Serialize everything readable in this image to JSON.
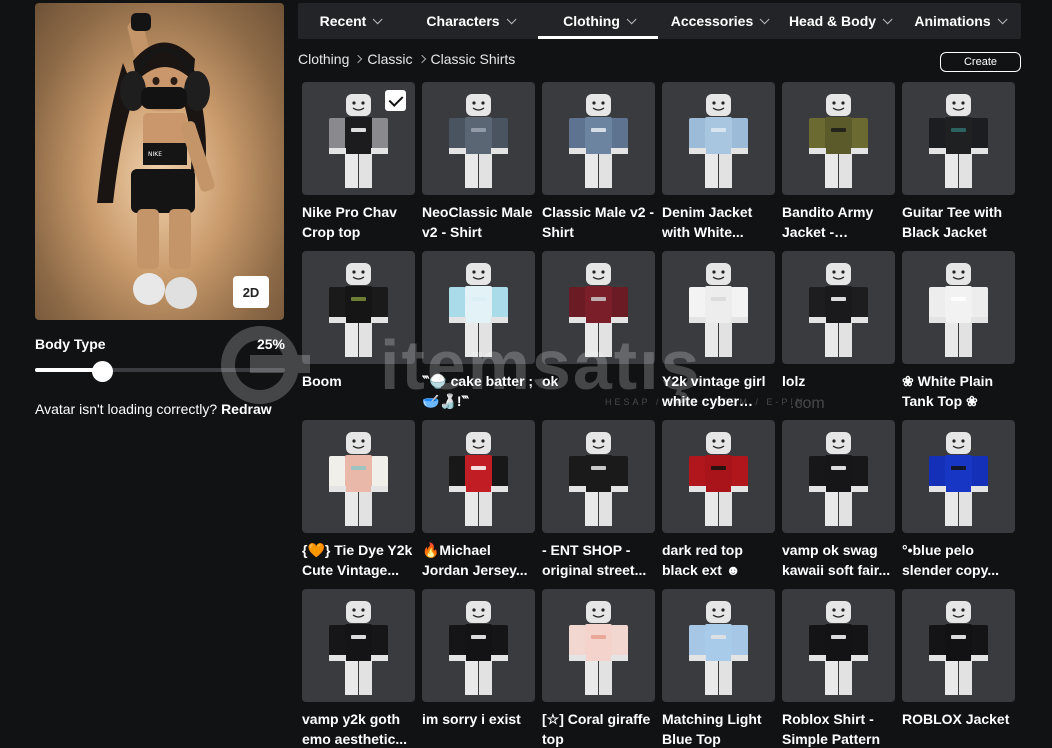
{
  "avatar": {
    "view_toggle_label": "2D",
    "body_type_label": "Body Type",
    "body_type_value": "25%",
    "body_type_fraction": 0.25,
    "loading_help_text": "Avatar isn't loading correctly?",
    "redraw_label": "Redraw"
  },
  "tabs": [
    {
      "label": "Recent"
    },
    {
      "label": "Characters"
    },
    {
      "label": "Clothing",
      "active": true
    },
    {
      "label": "Accessories"
    },
    {
      "label": "Head & Body"
    },
    {
      "label": "Animations"
    }
  ],
  "breadcrumb": [
    "Clothing",
    "Classic",
    "Classic Shirts"
  ],
  "create_label": "Create",
  "watermark": {
    "brand": "itemsatış",
    "tagline": "HESAP / SKIN / ITEM / E-PIN",
    "domain": ".com"
  },
  "items": [
    {
      "name": "Nike Pro Chav Crop top",
      "selected": true,
      "torso": "#1c1c1e",
      "arms": "#8a8a8e",
      "accent": "#ffffff"
    },
    {
      "name": "NeoClassic Male v2 - Shirt",
      "torso": "#5b6674",
      "arms": "#4a5460",
      "accent": "#9aa4b0"
    },
    {
      "name": "Classic Male v2 - Shirt",
      "torso": "#6d84a0",
      "arms": "#5d7390",
      "accent": "#e6ecf2"
    },
    {
      "name": "Denim Jacket with White...",
      "torso": "#a9c6e0",
      "arms": "#9cbbd8",
      "accent": "#dfe9f2"
    },
    {
      "name": "Bandito Army Jacket - Twenty...",
      "torso": "#5a5a2a",
      "arms": "#6b6a30",
      "accent": "#1b1b1b"
    },
    {
      "name": "Guitar Tee with Black Jacket",
      "torso": "#1e2022",
      "arms": "#1c1d20",
      "accent": "#2f6f6a"
    },
    {
      "name": "Boom",
      "torso": "#151515",
      "arms": "#1a1a1a",
      "accent": "#7c8f3a"
    },
    {
      "name": "‷🍚 cake batter ; 🥣🍶!‷",
      "torso": "#e2f2f6",
      "arms": "#a9dbe8",
      "accent": "#d9eef3"
    },
    {
      "name": "ok",
      "torso": "#7a1f2a",
      "arms": "#6a1b24",
      "accent": "#c9c9c9"
    },
    {
      "name": "Y2k vintage girl white cyber cut...",
      "torso": "#ededed",
      "arms": "#f3f3f3",
      "accent": "#d8d8d8"
    },
    {
      "name": "lolz",
      "torso": "#1a1a1d",
      "arms": "#1d1d20",
      "accent": "#ffffff"
    },
    {
      "name": "❀ White Plain Tank Top ❀",
      "torso": "#f2f2f2",
      "arms": "#ededed",
      "accent": "#ffffff"
    },
    {
      "name": "{🧡} Tie Dye Y2k Cute Vintage...",
      "torso": "#e9b8a8",
      "arms": "#f0efea",
      "accent": "#8fc6c4"
    },
    {
      "name": "🔥Michael Jordan Jersey...",
      "torso": "#c01e24",
      "arms": "#181818",
      "accent": "#ffffff"
    },
    {
      "name": "- ENT SHOP - original street...",
      "torso": "#1a1a1a",
      "arms": "#1a1a1a",
      "accent": "#e8e8e8"
    },
    {
      "name": "dark red top black ext ☻",
      "torso": "#a8141a",
      "arms": "#b2161d",
      "accent": "#111111"
    },
    {
      "name": "vamp ok swag kawaii soft fair...",
      "torso": "#161618",
      "arms": "#17171a",
      "accent": "#ffffff"
    },
    {
      "name": "°•blue pelo slender copy...",
      "torso": "#1836c4",
      "arms": "#1530b8",
      "accent": "#111111"
    },
    {
      "name": "vamp y2k goth emo aesthetic...",
      "torso": "#141416",
      "arms": "#161618",
      "accent": "#ffffff"
    },
    {
      "name": "im sorry i exist",
      "torso": "#131315",
      "arms": "#151517",
      "accent": "#ffffff"
    },
    {
      "name": "[☆] Coral giraffe top",
      "torso": "#f3d3cc",
      "arms": "#f2d6d0",
      "accent": "#e8a090"
    },
    {
      "name": "Matching Light Blue Top",
      "torso": "#a8cbea",
      "arms": "#a6c8e6",
      "accent": "#e4e4e4"
    },
    {
      "name": "Roblox Shirt - Simple Pattern",
      "torso": "#131315",
      "arms": "#141416",
      "accent": "#ffffff"
    },
    {
      "name": "ROBLOX Jacket",
      "torso": "#121214",
      "arms": "#141416",
      "accent": "#ffffff"
    }
  ]
}
